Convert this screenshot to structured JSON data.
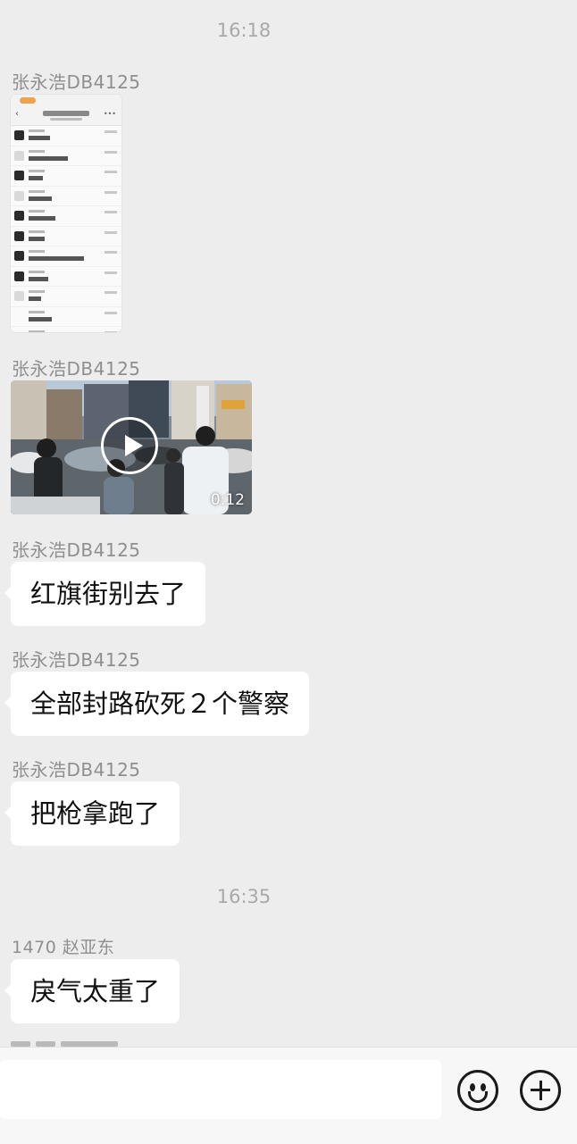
{
  "chat": {
    "timestamps": [
      "16:18",
      "16:35"
    ],
    "messages": [
      {
        "sender": "张永浩DB4125",
        "type": "image"
      },
      {
        "sender": "张永浩DB4125",
        "type": "video",
        "duration": "0:12"
      },
      {
        "sender": "张永浩DB4125",
        "type": "text",
        "text": "红旗街别去了"
      },
      {
        "sender": "张永浩DB4125",
        "type": "text",
        "text": "全部封路砍死２个警察"
      },
      {
        "sender": "张永浩DB4125",
        "type": "text",
        "text": "把枪拿跑了"
      },
      {
        "sender": "1470 赵亚东",
        "type": "text",
        "text": "戾气太重了"
      }
    ]
  },
  "input_bar": {
    "value": "",
    "icons": [
      "emoji-icon",
      "plus-icon"
    ]
  },
  "colors": {
    "background": "#ededed",
    "bubble": "#ffffff",
    "sender_text": "#8f8f8f",
    "timestamp_text": "#a9a9a9"
  }
}
